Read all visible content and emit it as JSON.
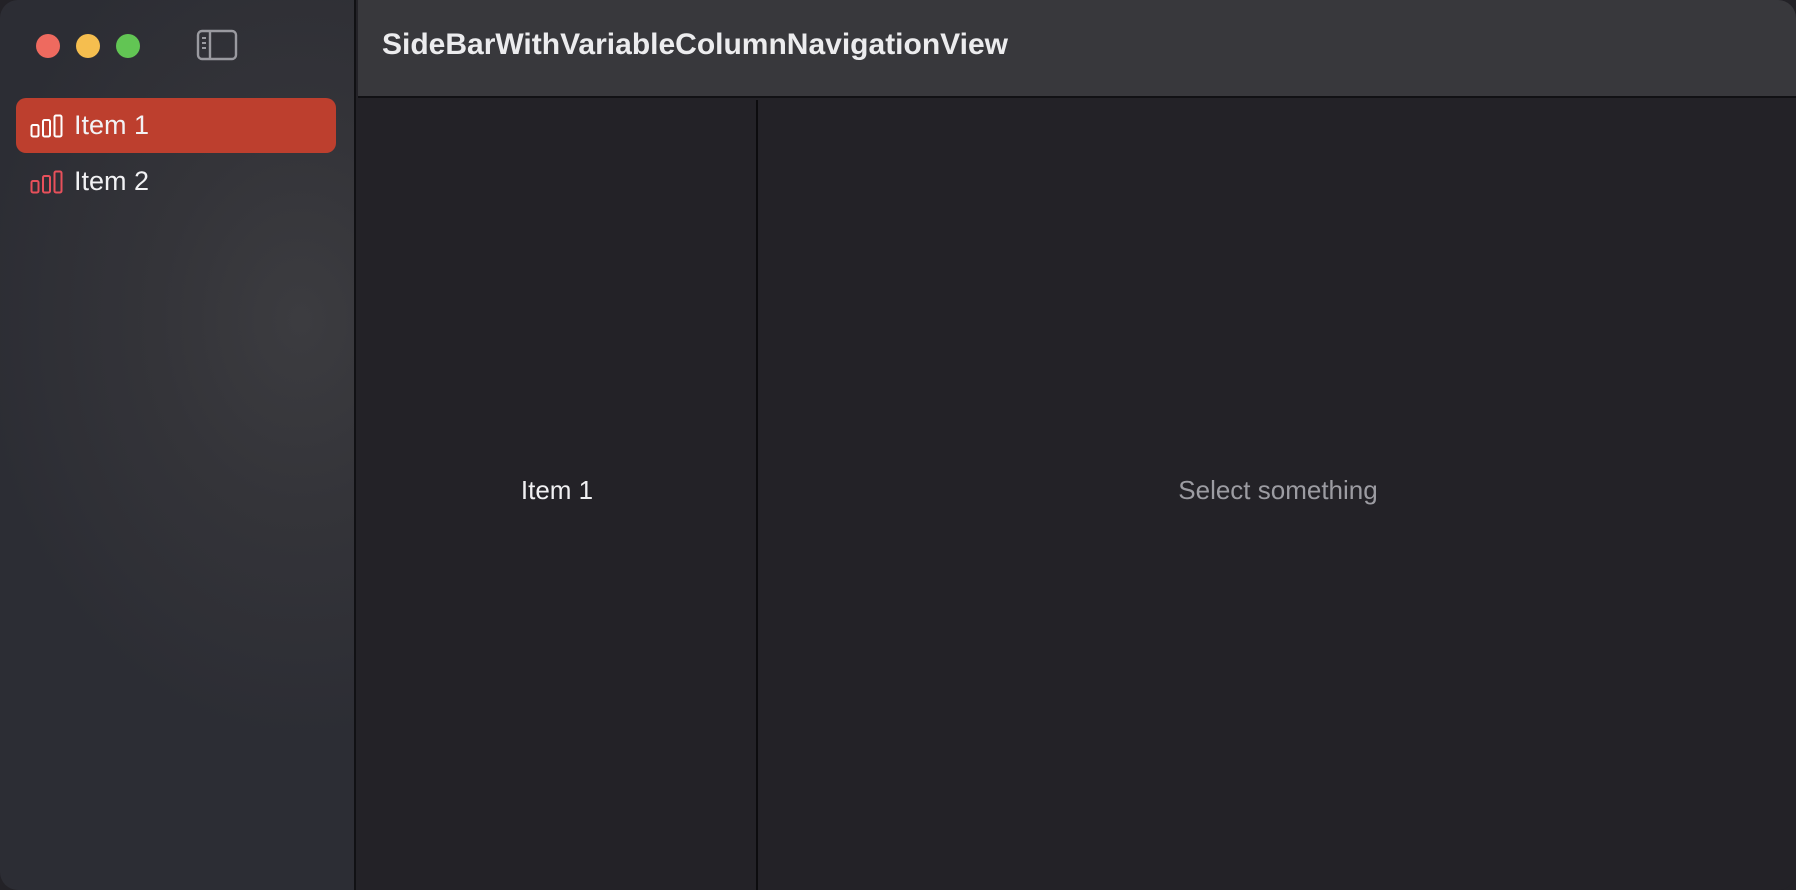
{
  "window": {
    "title": "SideBarWithVariableColumnNavigationView"
  },
  "toolbar": {
    "sidebar_toggle_icon": "sidebar-left-icon"
  },
  "sidebar": {
    "items": [
      {
        "label": "Item 1",
        "icon": "chart-bar-icon",
        "selected": true
      },
      {
        "label": "Item 2",
        "icon": "chart-bar-icon",
        "selected": false
      }
    ]
  },
  "content": {
    "middle_text": "Item 1",
    "detail_placeholder": "Select something"
  },
  "colors": {
    "accent": "#bd3f2e",
    "icon_unselected": "#e8505b",
    "close": "#ee6a5f",
    "minimize": "#f5be4f",
    "zoom": "#62c554"
  }
}
